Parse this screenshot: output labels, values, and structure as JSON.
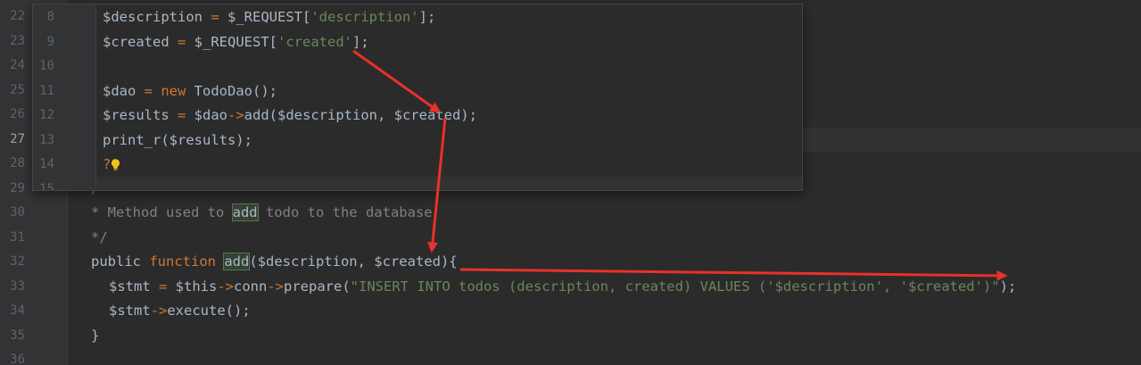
{
  "editor": {
    "line_numbers": [
      "22",
      "23",
      "24",
      "25",
      "26",
      "27",
      "28",
      "29",
      "30",
      "31",
      "32",
      "33",
      "34",
      "35",
      "36"
    ],
    "current_line": "27",
    "lines": {
      "l29": "/**",
      "l30_a": "* Method used to ",
      "l30_b": "add",
      "l30_c": " todo to the database",
      "l31": "*/",
      "l32_a": "public ",
      "l32_b": "function ",
      "l32_c": "add",
      "l32_d": "($description, $created){",
      "l33_a": "$stmt ",
      "l33_b": "= ",
      "l33_c": "$this",
      "l33_d": "->",
      "l33_e": "conn",
      "l33_f": "->",
      "l33_g": "prepare(",
      "l33_h": "\"INSERT INTO todos (description, created) VALUES ('$description', '$created')\"",
      "l33_i": ");",
      "l34_a": "$stmt",
      "l34_b": "->",
      "l34_c": "execute();",
      "l35": "}"
    }
  },
  "popup": {
    "line_numbers": [
      "8",
      "9",
      "10",
      "11",
      "12",
      "13",
      "14",
      "15"
    ],
    "lines": {
      "p8_a": "$description ",
      "p8_b": "= ",
      "p8_c": "$_REQUEST[",
      "p8_d": "'description'",
      "p8_e": "];",
      "p9_a": "$created ",
      "p9_b": "= ",
      "p9_c": "$_REQUEST[",
      "p9_d": "'created'",
      "p9_e": "];",
      "p11_a": "$dao ",
      "p11_b": "= ",
      "p11_c": "new ",
      "p11_d": "TodoDao();",
      "p12_a": "$results ",
      "p12_b": "= ",
      "p12_c": "$dao",
      "p12_d": "->",
      "p12_e": "add($description, $created);",
      "p13": "print_r($results);",
      "p14": "?"
    }
  },
  "icons": {
    "intention": "lightbulb-icon"
  },
  "colors": {
    "background": "#2b2b2b",
    "keyword": "#cc7832",
    "string": "#6a8759",
    "comment": "#808080",
    "text": "#a9b7c6",
    "annotation_arrow": "#e8312a",
    "bulb": "#f0c419"
  }
}
